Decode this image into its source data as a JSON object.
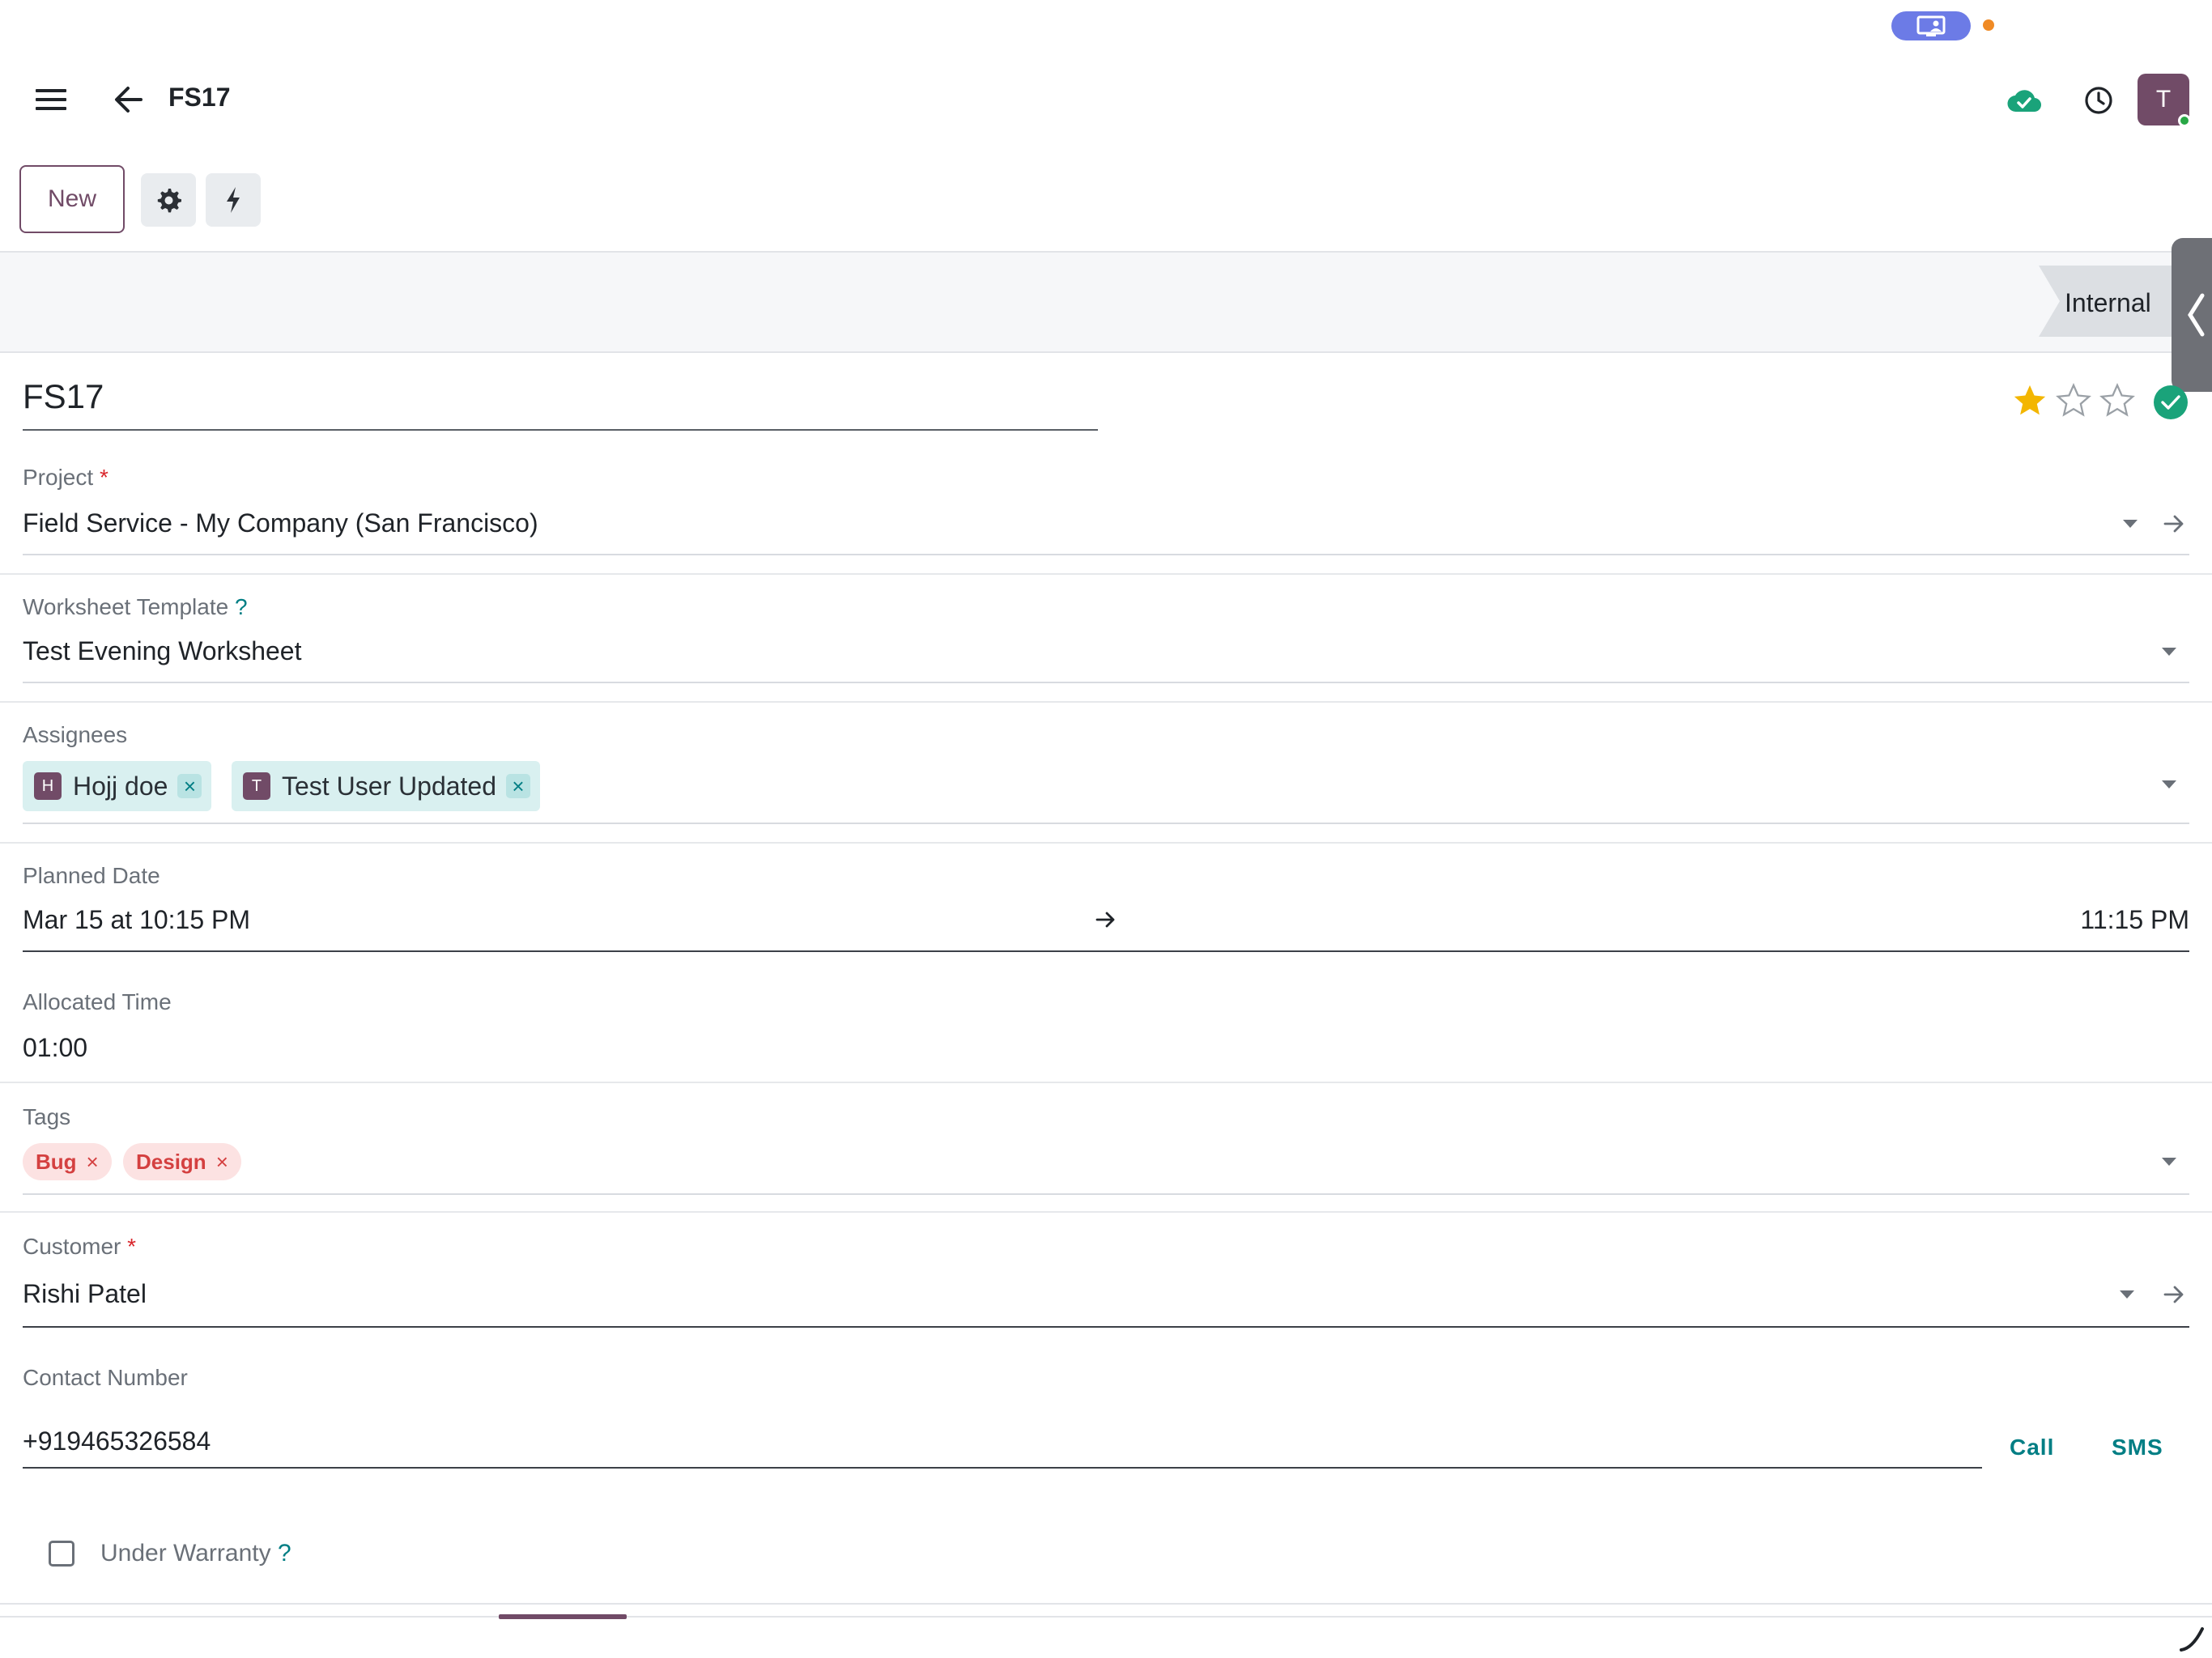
{
  "system": {
    "pill_icon": "screen-share-icon"
  },
  "header": {
    "title": "FS17",
    "menu_icon": "hamburger-menu-icon",
    "back_icon": "arrow-left-icon",
    "sync_icon": "cloud-check-icon",
    "activity_icon": "clock-icon",
    "avatar_initial": "T"
  },
  "control_panel": {
    "new_label": "New",
    "settings_icon": "gear-icon",
    "actions_icon": "bolt-icon"
  },
  "status": {
    "ribbon_label": "Internal",
    "side_tab_icon": "chevron-left-icon"
  },
  "record": {
    "name": "FS17",
    "priority_stars": 1,
    "priority_max": 3
  },
  "fields": {
    "project": {
      "label": "Project",
      "required": "*",
      "value": "Field Service - My Company (San Francisco)"
    },
    "worksheet_template": {
      "label": "Worksheet Template",
      "help": "?",
      "value": "Test Evening Worksheet"
    },
    "assignees": {
      "label": "Assignees",
      "items": [
        {
          "initial": "H",
          "name": "Hojj doe"
        },
        {
          "initial": "T",
          "name": "Test User Updated"
        }
      ]
    },
    "planned_date": {
      "label": "Planned Date",
      "start": "Mar 15 at 10:15 PM",
      "end": "11:15 PM"
    },
    "allocated_time": {
      "label": "Allocated Time",
      "value": "01:00"
    },
    "tags": {
      "label": "Tags",
      "items": [
        {
          "name": "Bug"
        },
        {
          "name": "Design"
        }
      ]
    },
    "customer": {
      "label": "Customer",
      "required": "*",
      "value": "Rishi Patel"
    },
    "contact_number": {
      "label": "Contact Number",
      "value": "+919465326584",
      "call_label": "Call",
      "sms_label": "SMS"
    },
    "under_warranty": {
      "label": "Under Warranty",
      "help": "?",
      "checked": false
    }
  },
  "colors": {
    "brand": "#714b67",
    "accent": "#017e84",
    "star_filled": "#f3b600",
    "done": "#1aa37a",
    "tag_text": "#d44040"
  },
  "glyphs": {
    "remove": "×"
  }
}
